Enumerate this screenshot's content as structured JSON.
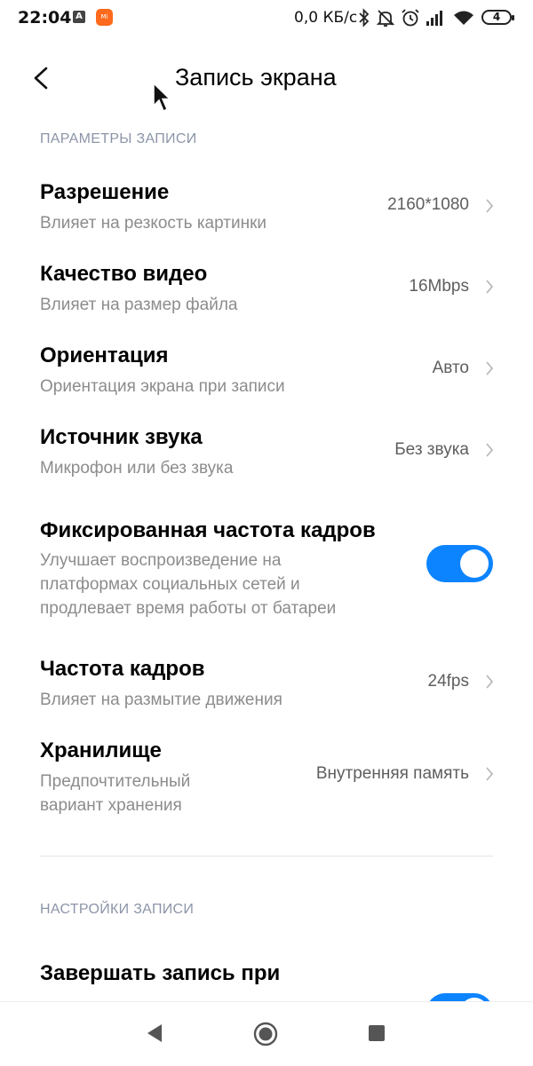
{
  "status_bar": {
    "time": "22:04",
    "notif_a": "A",
    "app_badge": "Mi",
    "net_speed": "0,0 КБ/с",
    "battery_level": "4",
    "icons": [
      "bluetooth-icon",
      "mute-icon",
      "alarm-icon",
      "signal-icon",
      "wifi-icon",
      "battery-icon"
    ]
  },
  "header": {
    "title": "Запись экрана",
    "back_icon": "chevron-left-icon"
  },
  "sections": {
    "params_header": "ПАРАМЕТРЫ ЗАПИСИ",
    "settings_header": "НАСТРОЙКИ ЗАПИСИ"
  },
  "rows": {
    "resolution": {
      "title": "Разрешение",
      "subtitle": "Влияет на резкость картинки",
      "value": "2160*1080"
    },
    "quality": {
      "title": "Качество видео",
      "subtitle": "Влияет на размер файла",
      "value": "16Mbps"
    },
    "orientation": {
      "title": "Ориентация",
      "subtitle": "Ориентация экрана при записи",
      "value": "Авто"
    },
    "sound": {
      "title": "Источник звука",
      "subtitle": "Микрофон или без звука",
      "value": "Без звука"
    },
    "fixed_fps": {
      "title": "Фиксированная частота кадров",
      "subtitle_lines": [
        "Улучшает воспроизведение на",
        "платформах социальных сетей и",
        "продлевает время работы от батареи"
      ],
      "enabled": true
    },
    "fps": {
      "title": "Частота кадров",
      "subtitle": "Влияет на размытие движения",
      "value": "24fps"
    },
    "storage": {
      "title": "Хранилище",
      "subtitle_lines": [
        "Предпочтительный",
        "вариант хранения"
      ],
      "value": "Внутренняя память"
    },
    "end_on_lock": {
      "title": "Завершать запись при",
      "enabled": true
    }
  },
  "colors": {
    "accent": "#0d84ff",
    "section_header": "#8c95a8",
    "subtitle": "#8c8c8c",
    "value": "#5e5e5e"
  },
  "navbar": {
    "icons": [
      "back-triangle-icon",
      "home-circle-icon",
      "recents-square-icon"
    ]
  }
}
